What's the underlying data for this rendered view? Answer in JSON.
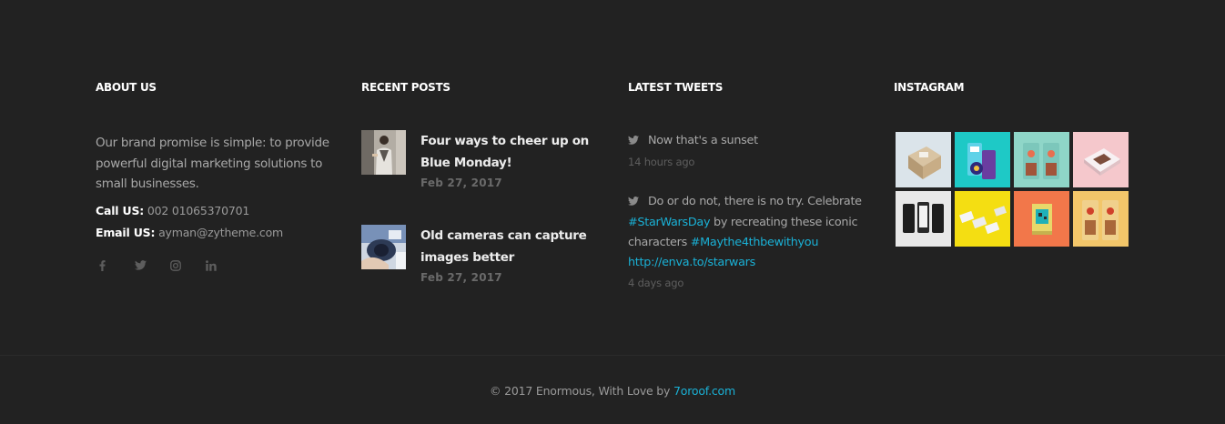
{
  "about": {
    "title": "ABOUT US",
    "text": "Our brand promise is simple: to provide powerful digital marketing solutions to small businesses.",
    "call_label": "Call US:",
    "call_value": "002 01065370701",
    "email_label": "Email US:",
    "email_value": "ayman@zytheme.com",
    "socials": [
      "facebook-icon",
      "twitter-icon",
      "instagram-icon",
      "linkedin-icon"
    ]
  },
  "posts": {
    "title": "RECENT POSTS",
    "items": [
      {
        "title": "Four ways to cheer up on Blue Monday!",
        "date": "Feb 27, 2017"
      },
      {
        "title": "Old cameras can capture images better",
        "date": "Feb 27, 2017"
      }
    ]
  },
  "tweets": {
    "title": "LATEST TWEETS",
    "items": [
      {
        "text": "Now that's a sunset",
        "time": "14 hours ago"
      },
      {
        "text_before": "Do or do not, there is no try. Celebrate",
        "hashtag1": "#StarWarsDay",
        "text_middle": "by recreating these iconic characters",
        "hashtag2": "#Maythe4thbewithyou",
        "link": "http://enva.to/starwars",
        "time": "4 days ago"
      }
    ]
  },
  "instagram": {
    "title": "INSTAGRAM",
    "tiles": [
      "#dbe4ea",
      "#1ec9c6",
      "#8fd6c8",
      "#f5c8cc",
      "#e8e8e8",
      "#f4de12",
      "#f2774a",
      "#f2c66a"
    ]
  },
  "footer": {
    "copyright_text": "© 2017 Enormous, With Love by",
    "copyright_link": "7oroof.com"
  },
  "colors": {
    "background": "#222222",
    "accent": "#1ab1d6",
    "heading": "#ffffff"
  }
}
